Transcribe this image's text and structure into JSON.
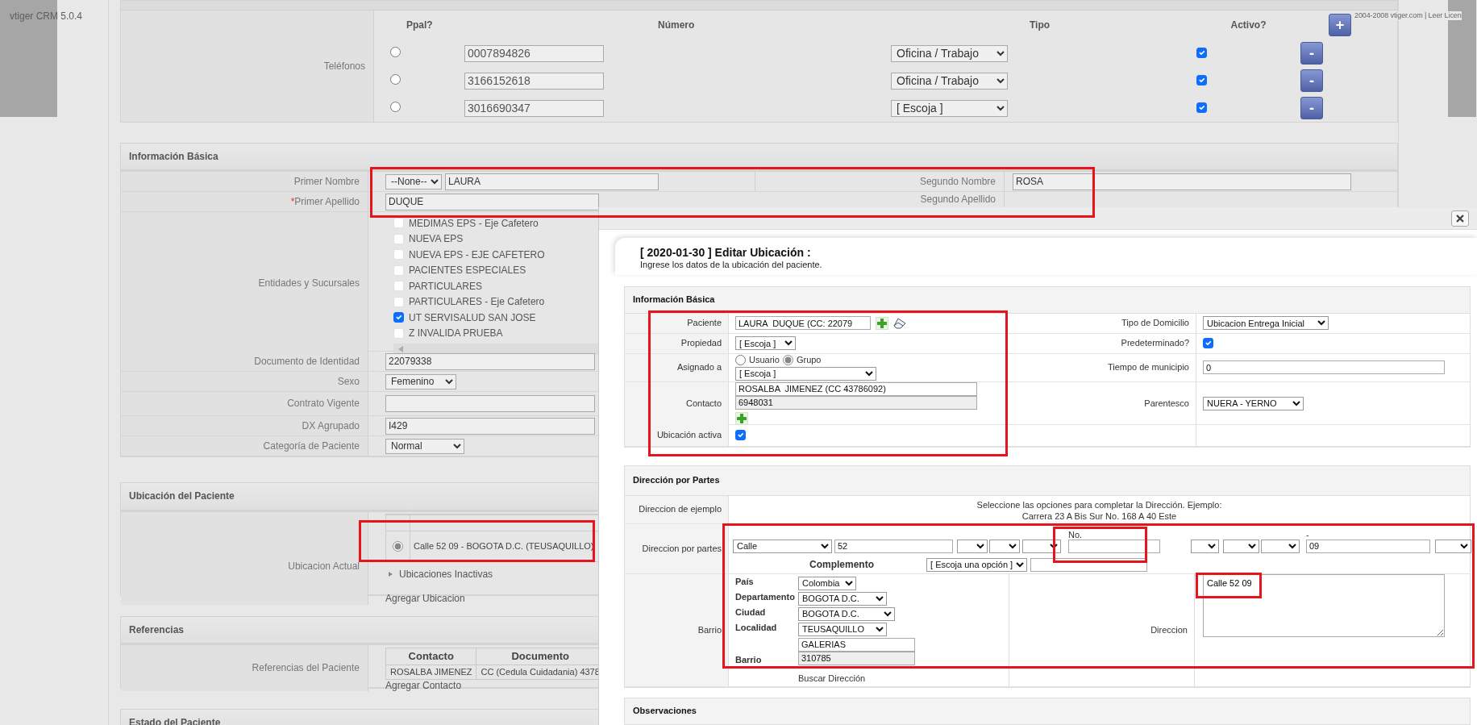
{
  "footer_texts": [
    "vtiger CRM 5.0.4",
    "2004-2008 vtiger.com | Leer Licen"
  ],
  "phones": {
    "label": "Teléfonos",
    "columns": [
      "Ppal?",
      "Número",
      "Tipo",
      "Activo?"
    ],
    "add_button": "+",
    "rows": [
      {
        "selected": false,
        "number": "0007894826",
        "type": "Oficina / Trabajo",
        "active": true,
        "remove_button": "-"
      },
      {
        "selected": false,
        "number": "3166152618",
        "type": "Oficina / Trabajo",
        "active": true,
        "remove_button": "-"
      },
      {
        "selected": false,
        "number": "3016690347",
        "type": "[ Escoja ]",
        "active": true,
        "remove_button": "-"
      }
    ]
  },
  "basic_info": {
    "title": "Información Básica",
    "first_name": {
      "label": "Primer Nombre",
      "salutation": "--None--",
      "value": "LAURA"
    },
    "second_name": {
      "label": "Segundo Nombre",
      "value": "ROSA"
    },
    "first_surname": {
      "label": "Primer Apellido",
      "required_mark": "*",
      "value": "DUQUE"
    },
    "second_surname": {
      "label": "Segundo Apellido"
    },
    "entities": {
      "label": "Entidades y Sucursales",
      "items": [
        {
          "name": "MEDIMAS EPS - Eje Cafetero",
          "checked": false
        },
        {
          "name": "NUEVA EPS",
          "checked": false
        },
        {
          "name": "NUEVA EPS - EJE CAFETERO",
          "checked": false
        },
        {
          "name": "PACIENTES ESPECIALES",
          "checked": false
        },
        {
          "name": "PARTICULARES",
          "checked": false
        },
        {
          "name": "PARTICULARES - Eje Cafetero",
          "checked": false
        },
        {
          "name": "UT SERVISALUD SAN JOSE",
          "checked": true
        },
        {
          "name": "Z INVALIDA PRUEBA",
          "checked": false
        }
      ]
    },
    "fields": [
      {
        "label": "Documento de Identidad",
        "kind": "input",
        "value": "22079338"
      },
      {
        "label": "Sexo",
        "kind": "select",
        "value": "Femenino"
      },
      {
        "label": "Contrato Vigente",
        "kind": "input"
      },
      {
        "label": "DX Agrupado",
        "kind": "input",
        "value": "I429"
      },
      {
        "label": "Categoría de Paciente",
        "kind": "select",
        "value": "Normal"
      }
    ]
  },
  "location": {
    "title": "Ubicación del Paciente",
    "label": "Ubicacion Actual",
    "current": {
      "selected": true,
      "text": "Calle 52 09 - BOGOTA D.C. (TEUSAQUILLO)"
    },
    "inactive_toggle": {
      "label": "Ubicaciones Inactivas",
      "expanded": false
    },
    "add_link": "Agregar Ubicacion"
  },
  "references": {
    "title": "Referencias",
    "label": "Referencias del Paciente",
    "columns": [
      "Contacto",
      "Documento"
    ],
    "rows": [
      [
        "ROSALBA JIMENEZ",
        "CC (Cedula Cuidadania) 4378"
      ]
    ],
    "add_link": "Agregar Contacto"
  },
  "status_section": {
    "title": "Estado del Paciente"
  },
  "modal": {
    "title": "[ 2020-01-30 ] Editar Ubicación :",
    "subtitle": "Ingrese los datos de la ubicación del paciente.",
    "basic": {
      "title": "Información Básica",
      "patient": {
        "label": "Paciente",
        "value": "LAURA  DUQUE (CC: 22079"
      },
      "property": {
        "label": "Propiedad",
        "value": "[ Escoja ]"
      },
      "assigned": {
        "label": "Asignado a",
        "options": [
          {
            "label": "Usuario",
            "selected": false
          },
          {
            "label": "Grupo",
            "selected": true
          }
        ],
        "value": "[ Escoja ]"
      },
      "contact": {
        "label": "Contacto",
        "name": "ROSALBA  JIMENEZ (CC 43786092)",
        "phone": "6948031"
      },
      "active": {
        "label": "Ubicación activa",
        "checked": true
      },
      "right": [
        {
          "label": "Tipo de Domicilio",
          "kind": "select",
          "value": "Ubicacion Entrega Inicial"
        },
        {
          "label": "Predeterminado?",
          "kind": "checkbox",
          "checked": true
        },
        {
          "label": "Tiempo de municipio",
          "kind": "input",
          "value": "0"
        },
        {
          "label": "Parentesco",
          "kind": "select",
          "value": "NUERA - YERNO"
        }
      ]
    },
    "address": {
      "title": "Dirección por Partes",
      "example_label": "Direccion de ejemplo",
      "example_lines": [
        "Seleccione las opciones para completar la Dirección. Ejemplo:",
        "Carrera 23 A Bis Sur No. 168 A 40 Este"
      ],
      "parts_label": "Direccion por partes",
      "parts": [
        {
          "kind": "select",
          "value": "Calle"
        },
        {
          "kind": "input",
          "value": "52"
        },
        {
          "kind": "select"
        },
        {
          "kind": "select"
        },
        {
          "kind": "select"
        },
        {
          "kind": "input",
          "caption": "No."
        },
        {
          "kind": "select"
        },
        {
          "kind": "select"
        },
        {
          "kind": "select"
        },
        {
          "kind": "input",
          "caption": "-",
          "value": "09"
        },
        {
          "kind": "select"
        }
      ],
      "complement": {
        "label": "Complemento",
        "value": "[ Escoja una opción ]"
      },
      "barrio_label": "Barrio",
      "location_fields": [
        {
          "label": "País",
          "value": "Colombia"
        },
        {
          "label": "Departamento",
          "value": "BOGOTA D.C."
        },
        {
          "label": "Ciudad",
          "value": "BOGOTA D.C."
        },
        {
          "label": "Localidad",
          "value": "TEUSAQUILLO"
        }
      ],
      "barrio": {
        "label": "Barrio",
        "name": "GALERIAS",
        "code": "310785"
      },
      "search_link": "Buscar Dirección",
      "direccion": {
        "label": "Direccion",
        "value": "Calle 52 09"
      }
    },
    "observations_title": "Observaciones"
  }
}
